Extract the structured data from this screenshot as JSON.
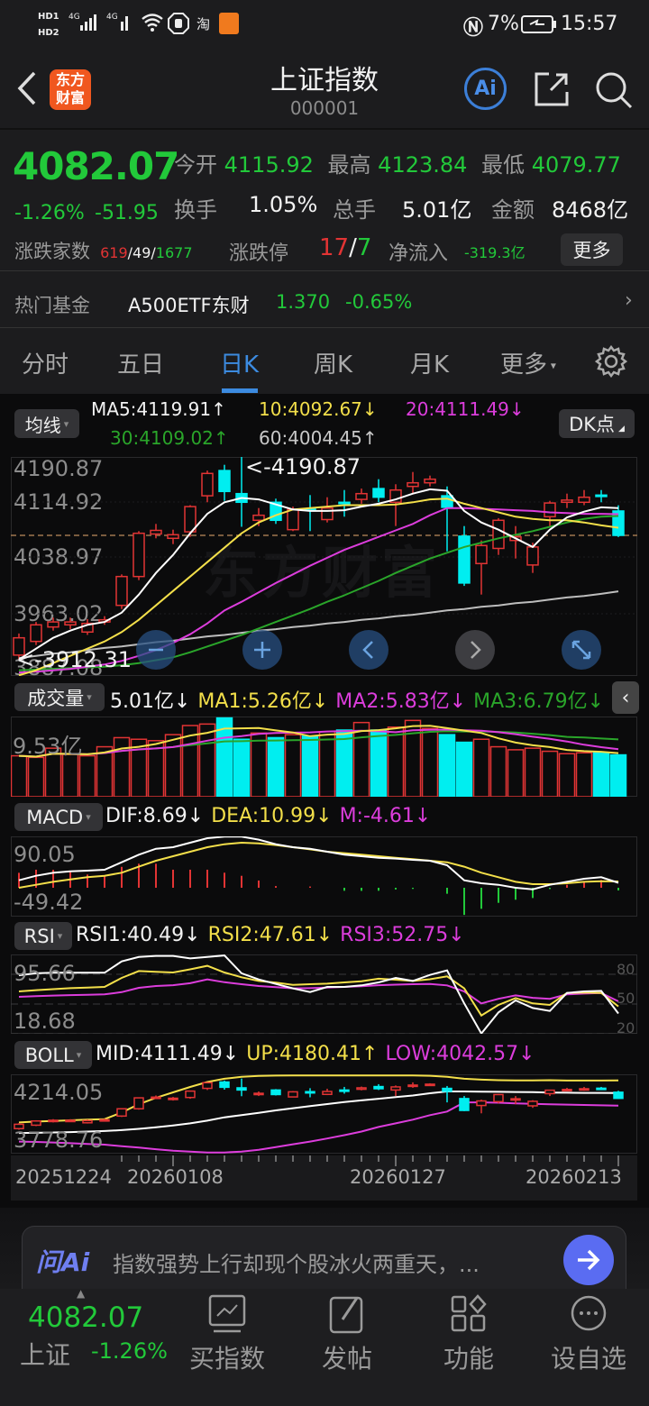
{
  "status": {
    "hd1": "HD1",
    "hd2": "HD2",
    "net1": "4G",
    "net2": "4G",
    "taobao": "淘",
    "battery": "7%",
    "time": "15:57"
  },
  "header": {
    "logo": "东方财富",
    "logo_line1": "东方",
    "logo_line2": "财富",
    "title": "上证指数",
    "code": "000001",
    "ai_label": "Ai"
  },
  "quote": {
    "price": "4082.07",
    "change_pct": "-1.26%",
    "change": "-51.95",
    "open_label": "今开",
    "open": "4115.92",
    "high_label": "最高",
    "high": "4123.84",
    "low_label": "最低",
    "low": "4079.77",
    "turnover_label": "换手",
    "turnover": "1.05%",
    "volume_label": "总手",
    "volume": "5.01亿",
    "amount_label": "金额",
    "amount": "8468亿",
    "breadth_label": "涨跌家数",
    "up_count": "619",
    "flat_count": "49",
    "down_count": "1677",
    "sep": "/",
    "limit_label": "涨跌停",
    "limit_up": "17",
    "limit_down": "7",
    "inflow_label": "净流入",
    "inflow": "-319.3亿",
    "more_button": "更多"
  },
  "fund": {
    "label": "热门基金",
    "name": "A500ETF东财",
    "price": "1.370",
    "change": "-0.65%"
  },
  "tabs": [
    {
      "label": "分时"
    },
    {
      "label": "五日"
    },
    {
      "label": "日K",
      "active": true
    },
    {
      "label": "周K"
    },
    {
      "label": "月K"
    },
    {
      "label": "更多"
    }
  ],
  "main": {
    "indicator_button": "均线",
    "dk_button": "DK点",
    "ma5": "MA5:4119.91↑",
    "ma10": "10:4092.67↓",
    "ma20": "20:4111.49↓",
    "ma30": "30:4109.02↑",
    "ma60": "60:4004.45↑",
    "y_labels": [
      "4190.87",
      "4114.92",
      "4038.97",
      "3963.02",
      "3887.08"
    ],
    "max_marker": "<-4190.87",
    "min_marker": "<-3912.31",
    "watermark": "东方财富",
    "current_price": 4082.07,
    "price_range": [
      3887.08,
      4190.87
    ]
  },
  "volume": {
    "button": "成交量",
    "value": "5.01亿↓",
    "ma1": "MA1:5.26亿↓",
    "ma2": "MA2:5.83亿↓",
    "ma3": "MA3:6.79亿↓",
    "y_label": "9.53亿",
    "ymax": 9.6
  },
  "macd": {
    "button": "MACD",
    "dif": "DIF:8.69↓",
    "dea": "DEA:10.99↓",
    "m": "M:-4.61↓",
    "y_top": "90.05",
    "y_bottom": "-49.42"
  },
  "rsi": {
    "button": "RSI",
    "rsi1": "RSI1:40.49↓",
    "rsi2": "RSI2:47.61↓",
    "rsi3": "RSI3:52.75↓",
    "y_top": "95.66",
    "y_bottom": "18.68",
    "levels": [
      "80",
      "50",
      "20"
    ]
  },
  "boll": {
    "button": "BOLL",
    "mid": "MID:4111.49↓",
    "up": "UP:4180.41↑",
    "low": "LOW:4042.57↓",
    "y_top": "4214.05",
    "y_bottom": "3778.76",
    "range": [
      3778.76,
      4214.05
    ]
  },
  "dates": [
    "20251224",
    "20260108",
    "20260127",
    "20260213"
  ],
  "ai_bar": {
    "brand": "问Ai",
    "text": "指数强势上行却现个股冰火两重天，..."
  },
  "bottom_nav": {
    "price": "4082.07",
    "name": "上证",
    "pct": "-1.26%",
    "items": [
      {
        "label": "买指数"
      },
      {
        "label": "发帖"
      },
      {
        "label": "功能"
      },
      {
        "label": "设自选"
      }
    ]
  },
  "colors": {
    "up": "#e23434",
    "down": "#00eef0",
    "green": "#22c93a",
    "accent": "#3c8be0",
    "ma5": "#ffffff",
    "ma10": "#f3df4a",
    "ma20": "#dc3ddc",
    "ma30": "#2aa52a",
    "ma60": "#bdbdbd"
  },
  "chart_data": {
    "type": "candlestick",
    "ohlc": [
      [
        3916,
        3946,
        3910,
        3940
      ],
      [
        3935,
        3962,
        3930,
        3958
      ],
      [
        3955,
        3968,
        3950,
        3962
      ],
      [
        3958,
        3968,
        3952,
        3962
      ],
      [
        3948,
        3966,
        3944,
        3960
      ],
      [
        3962,
        3970,
        3958,
        3965
      ],
      [
        3985,
        4028,
        3980,
        4025
      ],
      [
        4025,
        4088,
        4020,
        4085
      ],
      [
        4084,
        4098,
        4078,
        4089
      ],
      [
        4078,
        4090,
        4070,
        4083
      ],
      [
        4087,
        4124,
        4080,
        4122
      ],
      [
        4137,
        4172,
        4128,
        4168
      ],
      [
        4172,
        4180,
        4130,
        4143
      ],
      [
        4140,
        4190.87,
        4094,
        4128
      ],
      [
        4103,
        4120,
        4095,
        4110
      ],
      [
        4128,
        4133,
        4098,
        4103
      ],
      [
        4090,
        4122,
        4088,
        4118
      ],
      [
        4119,
        4138,
        4088,
        4118
      ],
      [
        4104,
        4135,
        4100,
        4120
      ],
      [
        4128,
        4145,
        4108,
        4126
      ],
      [
        4132,
        4147,
        4126,
        4140
      ],
      [
        4147,
        4160,
        4128,
        4135
      ],
      [
        4128,
        4153,
        4095,
        4145
      ],
      [
        4150,
        4170,
        4140,
        4155
      ],
      [
        4155,
        4165,
        4150,
        4160
      ],
      [
        4137,
        4150,
        4060,
        4121
      ],
      [
        4081,
        4095,
        4012,
        4016
      ],
      [
        4043,
        4075,
        4000,
        4068
      ],
      [
        4064,
        4106,
        4055,
        4103
      ],
      [
        4075,
        4095,
        4050,
        4080
      ],
      [
        4041,
        4072,
        4030,
        4066
      ],
      [
        4108,
        4130,
        4095,
        4127
      ],
      [
        4128,
        4140,
        4120,
        4131
      ],
      [
        4128,
        4145,
        4124,
        4135
      ],
      [
        4138,
        4145,
        4128,
        4136
      ],
      [
        4115.92,
        4123.84,
        4079.77,
        4082.07
      ]
    ],
    "ma5": [
      3910,
      3925,
      3940,
      3950,
      3958,
      3962,
      3975,
      4000,
      4030,
      4055,
      4085,
      4112,
      4128,
      4134,
      4132,
      4125,
      4118,
      4116,
      4116,
      4117,
      4122,
      4126,
      4132,
      4140,
      4146,
      4144,
      4116,
      4100,
      4090,
      4078,
      4066,
      4090,
      4107,
      4115,
      4121,
      4119.91
    ],
    "ma10": [
      3888,
      3895,
      3905,
      3915,
      3925,
      3935,
      3948,
      3965,
      3985,
      4005,
      4025,
      4045,
      4065,
      4085,
      4100,
      4110,
      4118,
      4120,
      4122,
      4124,
      4124,
      4124,
      4125,
      4128,
      4132,
      4133,
      4126,
      4120,
      4114,
      4108,
      4105,
      4103,
      4103,
      4100,
      4096,
      4092.67
    ],
    "ma20": [
      3892,
      3893,
      3895,
      3897,
      3900,
      3903,
      3908,
      3915,
      3923,
      3933,
      3945,
      3960,
      3978,
      3990,
      4003,
      4016,
      4028,
      4040,
      4051,
      4062,
      4071,
      4080,
      4089,
      4098,
      4110,
      4120,
      4120,
      4119,
      4118,
      4117,
      4116,
      4114,
      4113,
      4112,
      4112,
      4111.49
    ],
    "ma30": [
      3895,
      3896,
      3897,
      3898,
      3899,
      3900,
      3902,
      3905,
      3909,
      3913,
      3920,
      3928,
      3936,
      3944,
      3953,
      3962,
      3971,
      3980,
      3990,
      3999,
      4009,
      4019,
      4030,
      4040,
      4050,
      4058,
      4066,
      4072,
      4078,
      4083,
      4088,
      4094,
      4100,
      4105,
      4108,
      4109.02
    ],
    "ma60": [
      3912,
      3915,
      3918,
      3920,
      3923,
      3926,
      3928,
      3931,
      3934,
      3936,
      3939,
      3942,
      3944,
      3947,
      3950,
      3952,
      3955,
      3957,
      3960,
      3962,
      3965,
      3967,
      3970,
      3972,
      3975,
      3978,
      3980,
      3983,
      3985,
      3988,
      3990,
      3993,
      3996,
      3998,
      4001,
      4004.45
    ],
    "volume": [
      4.9,
      4.71,
      5.81,
      5.07,
      4.9,
      5.98,
      7.07,
      6.88,
      6.71,
      7.43,
      8.52,
      8.7,
      9.43,
      6.88,
      7.62,
      7.07,
      7.43,
      7.25,
      7.79,
      7.98,
      8.88,
      7.98,
      8.33,
      9.13,
      8.16,
      7.43,
      6.52,
      6.88,
      5.98,
      5.62,
      5.81,
      5.44,
      5.15,
      5.26,
      5.26,
      5.01
    ],
    "dif": [
      13,
      20.9,
      26,
      28.7,
      29.8,
      31.3,
      44.3,
      57.5,
      67.9,
      70.5,
      78.4,
      86.2,
      88.8,
      88.8,
      83.6,
      75.7,
      70.5,
      67.9,
      62.7,
      57.5,
      54.8,
      52.2,
      50.7,
      48.6,
      47,
      39.2,
      13,
      7.8,
      5.2,
      0,
      -2.6,
      5.2,
      10.4,
      15.7,
      18.3,
      8.69
    ],
    "dea": [
      0,
      5.2,
      10.4,
      14.6,
      18.3,
      20.9,
      26.1,
      36.6,
      47,
      54.8,
      62.7,
      70.5,
      75.7,
      78.4,
      77.3,
      74.2,
      70.5,
      66.8,
      62.7,
      60.1,
      57.5,
      54.8,
      52.2,
      49.6,
      47,
      44.4,
      36.6,
      26.1,
      18.3,
      10.4,
      6.3,
      6.3,
      7.8,
      10.4,
      11.5,
      10.99
    ],
    "rsi1": [
      79,
      81,
      81.5,
      81.5,
      81.5,
      81.5,
      93,
      97.5,
      98.5,
      98.5,
      96,
      97.5,
      99,
      81,
      74.8,
      70.3,
      65.8,
      62.1,
      67.3,
      67.3,
      68.8,
      71.8,
      76.4,
      73.3,
      79.4,
      83.9,
      50.6,
      20.3,
      41.5,
      53.6,
      46,
      43,
      61.2,
      62.7,
      63.3,
      40.49
    ],
    "rsi2": [
      62.7,
      64,
      65,
      66,
      66.5,
      67.3,
      76.4,
      83.3,
      82.5,
      81.8,
      85,
      88.5,
      81.8,
      77,
      73.3,
      71.5,
      69.4,
      70,
      70.5,
      71.8,
      73,
      75.5,
      74.5,
      73.3,
      75,
      77.9,
      65.8,
      38.5,
      49.1,
      56,
      50.6,
      49.1,
      61.2,
      61.5,
      61.2,
      47.61
    ],
    "rsi3": [
      57.3,
      58,
      58.5,
      59,
      59.3,
      59.7,
      62,
      66.4,
      68.2,
      69,
      71,
      74.8,
      72,
      70,
      68.2,
      67,
      65.8,
      66,
      66.5,
      67.3,
      68,
      69,
      69.5,
      70,
      70.3,
      68.8,
      62.7,
      50.6,
      55.3,
      58.7,
      56.3,
      55.3,
      59.7,
      60.5,
      61.2,
      52.75
    ],
    "boll_up": [
      3950,
      3955,
      3958,
      3962,
      3965,
      3968,
      4005,
      4050,
      4085,
      4115,
      4145,
      4172,
      4190,
      4200,
      4205,
      4207,
      4208,
      4208,
      4208,
      4208,
      4208,
      4208,
      4208,
      4208,
      4206,
      4200,
      4190,
      4185,
      4182,
      4181,
      4181,
      4182,
      4180,
      4180,
      4180,
      4180.41
    ],
    "boll_low": [
      3845,
      3843,
      3840,
      3836,
      3832,
      3828,
      3820,
      3812,
      3803,
      3795,
      3790,
      3785,
      3785,
      3790,
      3800,
      3815,
      3830,
      3845,
      3862,
      3880,
      3900,
      3925,
      3945,
      3965,
      3990,
      4010,
      4060,
      4060,
      4058,
      4055,
      4052,
      4050,
      4048,
      4046,
      4044,
      4042.57
    ],
    "date_label_index": [
      0,
      9,
      22,
      35
    ]
  }
}
